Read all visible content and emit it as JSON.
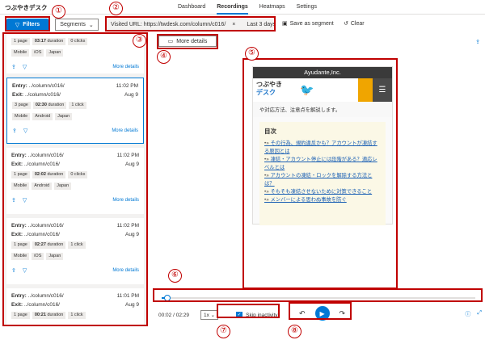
{
  "app": {
    "title": "つぶやきデスク"
  },
  "nav": {
    "tabs": [
      {
        "label": "Dashboard"
      },
      {
        "label": "Recordings"
      },
      {
        "label": "Heatmaps"
      },
      {
        "label": "Settings"
      }
    ]
  },
  "filterbar": {
    "filters_label": "Filters",
    "segments_label": "Segments",
    "chip_url": "Visited URL: https://twdesk.com/column/c016/",
    "chip_close": "×",
    "chip_range": "Last 3 days",
    "save_label": "Save as segment",
    "clear_label": "Clear"
  },
  "recordings": {
    "top_partial": {
      "pages": "1 page",
      "duration": "03:17",
      "duration_unit": "duration",
      "clicks": "0 clicks",
      "tags": [
        "Mobile",
        "iOS",
        "Japan"
      ]
    },
    "more_label": "More details",
    "entry_label": "Entry:",
    "exit_label": "Exit:",
    "items": [
      {
        "entry": "../column/c016/",
        "exit": "../column/c016/",
        "time": "11:02 PM",
        "date": "Aug 9",
        "pages": "3 page",
        "duration": "02:30",
        "duration_unit": "duration",
        "clicks": "1 click",
        "tags": [
          "Mobile",
          "Android",
          "Japan"
        ],
        "selected": true
      },
      {
        "entry": "../column/c016/",
        "exit": "../column/c016/",
        "time": "11:02 PM",
        "date": "Aug 9",
        "pages": "1 page",
        "duration": "02:02",
        "duration_unit": "duration",
        "clicks": "0 clicks",
        "tags": [
          "Mobile",
          "Android",
          "Japan"
        ],
        "selected": false
      },
      {
        "entry": "../column/c016/",
        "exit": "../column/c016/",
        "time": "11:02 PM",
        "date": "Aug 9",
        "pages": "1 page",
        "duration": "02:27",
        "duration_unit": "duration",
        "clicks": "1 click",
        "tags": [
          "Mobile",
          "iOS",
          "Japan"
        ],
        "selected": false
      },
      {
        "entry": "../column/c016/",
        "exit": "../column/c016/",
        "time": "11:01 PM",
        "date": "Aug 9",
        "pages": "1 page",
        "duration": "00:21",
        "duration_unit": "duration",
        "clicks": "1 click",
        "tags": [],
        "selected": false
      }
    ]
  },
  "player": {
    "more_details_label": "More details",
    "preview": {
      "company": "Ayudante,Inc.",
      "logo_line1": "つぶやき",
      "logo_line2": "デスク",
      "intro": "や対応方法、注意点を解説します。",
      "toc_title": "目次",
      "toc_items": [
        "その行為、規約違反かも？アカウントが凍結する原因とは",
        "凍結・アカウント停止には段階がある？適応レベルとは",
        "アカウントの凍結・ロックを解除する方法とは？",
        "そもそも凍結させないために対策できること",
        "メンバーによる思わぬ事故を防ぐ"
      ]
    },
    "progress": 0.01,
    "current_time": "00:02",
    "total_time": "02:29",
    "speed": "1x",
    "skip_inactivity_label": "Skip inactivity",
    "skip_inactivity_checked": true
  },
  "callouts": [
    "①",
    "②",
    "③",
    "④",
    "⑤",
    "⑥",
    "⑦",
    "⑧"
  ],
  "colors": {
    "accent": "#0078d4",
    "callout": "#c00000"
  }
}
